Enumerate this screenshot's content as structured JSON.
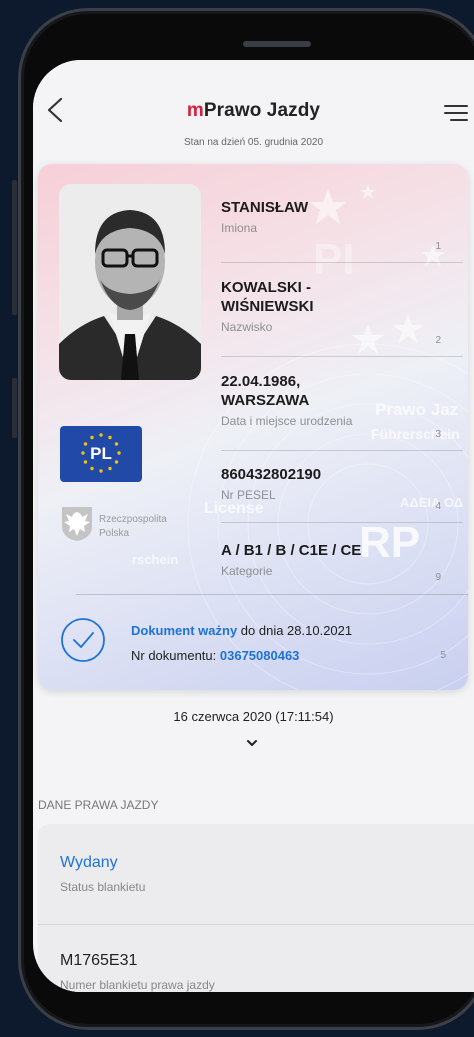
{
  "header": {
    "title_prefix": "m",
    "title_rest": "Prawo Jazdy",
    "status_date": "Stan na dzień 05. grudnia 2020"
  },
  "card": {
    "fields": [
      {
        "value": "STANISŁAW",
        "label": "Imiona",
        "num": "1"
      },
      {
        "value": "KOWALSKI - WIŚNIEWSKI",
        "label": "Nazwisko",
        "num": "2"
      },
      {
        "value": "22.04.1986, WARSZAWA",
        "label": "Data i miejsce urodzenia",
        "num": "3"
      },
      {
        "value": "860432802190",
        "label": "Nr PESEL",
        "num": "4"
      },
      {
        "value": "A / B1 / B / C1E / CE",
        "label": "Kategorie",
        "num": "9"
      }
    ],
    "flag_code": "PL",
    "country_line1": "Rzeczpospolita",
    "country_line2": "Polska",
    "watermarks": {
      "prawo_jazdy": "Prawo Jaz",
      "fuhrerschein": "Führerschein",
      "license": "License",
      "adeia": "ΑΔΕΙΑ ΟΔ",
      "rp": "RP",
      "rschein": "rschein"
    },
    "validity": {
      "valid_label": "Dokument ważny",
      "valid_until": " do dnia 28.10.2021",
      "doc_label": "Nr dokumentu: ",
      "doc_number": "03675080463",
      "num": "5"
    }
  },
  "timestamp": "16 czerwca 2020 (17:11:54)",
  "section": {
    "title": "DANE PRAWA JAZDY",
    "items": [
      {
        "value": "Wydany",
        "label": "Status blankietu"
      },
      {
        "value": "M1765E31",
        "label": "Numer blankietu prawa jazdy"
      }
    ]
  },
  "colors": {
    "accent_red": "#d4213d",
    "accent_blue": "#1e73d8",
    "flag_blue": "#2149a8"
  },
  "icons": [
    "back-icon",
    "menu-icon",
    "check-circle-icon",
    "chevron-down-icon",
    "eagle-icon",
    "eu-stars-icon"
  ]
}
